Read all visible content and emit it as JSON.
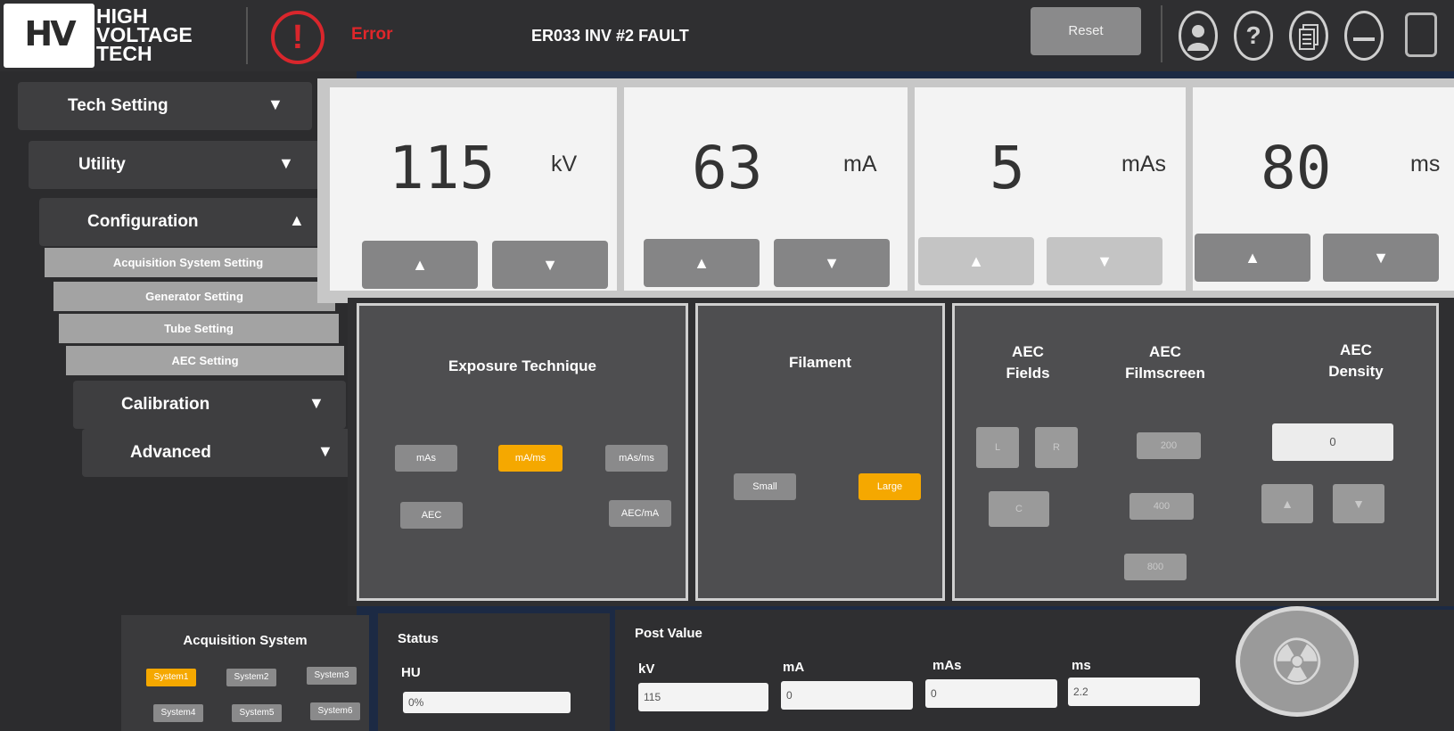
{
  "header": {
    "logo_mark": "HV",
    "logo_lines": [
      "HIGH",
      "VOLTAGE",
      "TECH"
    ],
    "error_label": "Error",
    "fault_message": "ER033 INV #2 FAULT",
    "reset_label": "Reset"
  },
  "sidebar": {
    "tech_setting": "Tech Setting",
    "utility": "Utility",
    "configuration": "Configuration",
    "configuration_items": [
      "Acquisition System Setting",
      "Generator Setting",
      "Tube Setting",
      "AEC Setting"
    ],
    "calibration": "Calibration",
    "advanced": "Advanced"
  },
  "params": [
    {
      "value": "115",
      "unit": "kV"
    },
    {
      "value": "63",
      "unit": "mA"
    },
    {
      "value": "5",
      "unit": "mAs"
    },
    {
      "value": "80",
      "unit": "ms"
    }
  ],
  "exposure_technique": {
    "title": "Exposure Technique",
    "options": [
      "mAs",
      "mA/ms",
      "mAs/ms",
      "AEC",
      "AEC/mA"
    ],
    "selected": "mA/ms"
  },
  "filament": {
    "title": "Filament",
    "options": [
      "Small",
      "Large"
    ],
    "selected": "Large"
  },
  "aec": {
    "fields_title": "AEC\nFields",
    "fields_title_l1": "AEC",
    "fields_title_l2": "Fields",
    "fields": [
      "L",
      "R",
      "C"
    ],
    "filmscreen_title_l1": "AEC",
    "filmscreen_title_l2": "Filmscreen",
    "filmscreen": [
      "200",
      "400",
      "800"
    ],
    "density_title_l1": "AEC",
    "density_title_l2": "Density",
    "density_value": "0"
  },
  "acquisition_system": {
    "title": "Acquisition System",
    "systems": [
      "System1",
      "System2",
      "System3",
      "System4",
      "System5",
      "System6"
    ],
    "selected": "System1"
  },
  "status": {
    "title": "Status",
    "hu_label": "HU",
    "hu_value": "0%"
  },
  "post_value": {
    "title": "Post Value",
    "labels": [
      "kV",
      "mA",
      "mAs",
      "ms"
    ],
    "values": [
      "115",
      "0",
      "0",
      "2.2"
    ]
  },
  "colors": {
    "error": "#e0262a",
    "active": "#f5a800",
    "panel": "#4e4e50",
    "card": "#f3f3f3"
  },
  "icons": [
    "error-icon",
    "user-icon",
    "help-icon",
    "documents-icon",
    "minimize-icon",
    "window-icon",
    "radiation-icon"
  ]
}
